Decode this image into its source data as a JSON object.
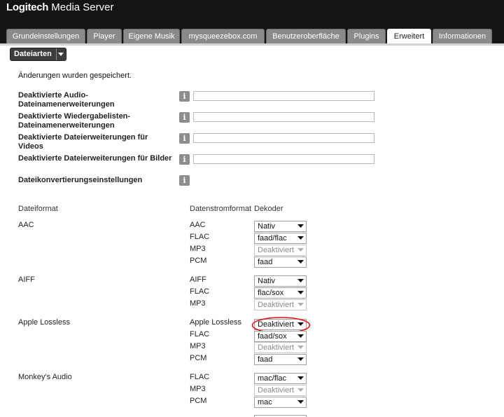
{
  "app": {
    "brand_bold": "Logitech",
    "brand_rest": "Media Server"
  },
  "tabs": [
    {
      "label": "Grundeinstellungen",
      "active": false
    },
    {
      "label": "Player",
      "active": false
    },
    {
      "label": "Eigene Musik",
      "active": false
    },
    {
      "label": "mysqueezebox.com",
      "active": false
    },
    {
      "label": "Benutzeroberfläche",
      "active": false
    },
    {
      "label": "Plugins",
      "active": false
    },
    {
      "label": "Erweitert",
      "active": true
    },
    {
      "label": "Informationen",
      "active": false
    }
  ],
  "submenu": {
    "label": "Dateiarten"
  },
  "status": {
    "message": "Änderungen wurden gespeichert."
  },
  "settings": [
    {
      "label": "Deaktivierte Audio-",
      "label2": "Dateinamenerweiterungen",
      "value": ""
    },
    {
      "label": "Deaktivierte Wiedergabelisten-",
      "label2": "Dateinamenerweiterungen",
      "value": ""
    },
    {
      "label": "Deaktivierte Dateierweiterungen für",
      "label2": "Videos",
      "value": ""
    },
    {
      "label": "Deaktivierte Dateierweiterungen für Bilder",
      "label2": "",
      "value": ""
    }
  ],
  "conversion": {
    "label": "Dateikonvertierungseinstellungen"
  },
  "table": {
    "headers": {
      "format": "Dateiformat",
      "stream": "Datenstromformat",
      "decoder": "Dekoder"
    },
    "groups": [
      {
        "format": "AAC",
        "rows": [
          {
            "stream": "AAC",
            "decoder": "Nativ",
            "disabled": false
          },
          {
            "stream": "FLAC",
            "decoder": "faad/flac",
            "disabled": false
          },
          {
            "stream": "MP3",
            "decoder": "Deaktiviert",
            "disabled": true
          },
          {
            "stream": "PCM",
            "decoder": "faad",
            "disabled": false
          }
        ]
      },
      {
        "format": "AIFF",
        "rows": [
          {
            "stream": "AIFF",
            "decoder": "Nativ",
            "disabled": false
          },
          {
            "stream": "FLAC",
            "decoder": "flac/sox",
            "disabled": false
          },
          {
            "stream": "MP3",
            "decoder": "Deaktiviert",
            "disabled": true
          }
        ]
      },
      {
        "format": "Apple Lossless",
        "rows": [
          {
            "stream": "Apple Lossless",
            "decoder": "Deaktiviert",
            "disabled": false,
            "highlighted": true
          },
          {
            "stream": "FLAC",
            "decoder": "faad/sox",
            "disabled": false
          },
          {
            "stream": "MP3",
            "decoder": "Deaktiviert",
            "disabled": true
          },
          {
            "stream": "PCM",
            "decoder": "faad",
            "disabled": false
          }
        ]
      },
      {
        "format": "Monkey's Audio",
        "rows": [
          {
            "stream": "FLAC",
            "decoder": "mac/flac",
            "disabled": false
          },
          {
            "stream": "MP3",
            "decoder": "Deaktiviert",
            "disabled": true
          },
          {
            "stream": "PCM",
            "decoder": "mac",
            "disabled": false
          }
        ]
      }
    ]
  },
  "icons": {
    "info": "info-icon",
    "dropdown": "chevron-down-icon"
  },
  "colors": {
    "topbar": "#141414",
    "tab": "#8a8a8a",
    "annotation": "#e01010"
  }
}
